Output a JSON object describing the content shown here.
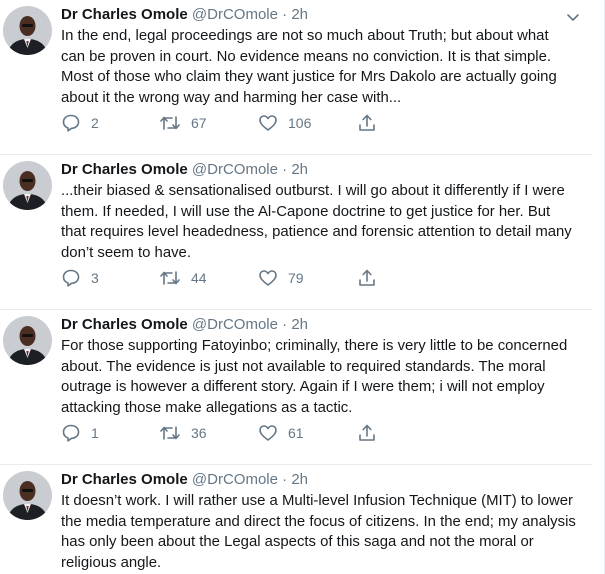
{
  "tweets": [
    {
      "name": "Dr Charles Omole",
      "handle": "@DrCOmole",
      "separator": "·",
      "time": "2h",
      "lines": [
        "In the end, legal proceedings are not so much about Truth; but about what",
        "can be proven in court. No evidence means no conviction. It is that simple.",
        "Most of those who claim they want justice for Mrs Dakolo are actually going",
        "about it the wrong way and harming her case with..."
      ],
      "replies": "2",
      "retweets": "67",
      "likes": "106"
    },
    {
      "name": "Dr Charles Omole",
      "handle": "@DrCOmole",
      "separator": "·",
      "time": "2h",
      "lines": [
        "...their biased & sensationalised outburst. I will go about it differently if I were",
        "them. If needed, I will use the Al-Capone doctrine to get justice for her. But",
        "that requires level headedness, patience and forensic attention to detail many",
        "don’t seem to have."
      ],
      "replies": "3",
      "retweets": "44",
      "likes": "79"
    },
    {
      "name": "Dr Charles Omole",
      "handle": "@DrCOmole",
      "separator": "·",
      "time": "2h",
      "lines": [
        "For those supporting Fatoyinbo; criminally, there is very little to be concerned",
        "about. The evidence is just not available to required standards. The moral",
        "outrage is however a different story. Again if I were them; i will not employ",
        "attacking those make allegations as a tactic."
      ],
      "replies": "1",
      "retweets": "36",
      "likes": "61"
    },
    {
      "name": "Dr Charles Omole",
      "handle": "@DrCOmole",
      "separator": "·",
      "time": "2h",
      "lines": [
        "It doesn’t work. I will rather use a Multi-level Infusion Technique (MIT) to lower",
        "the media temperature and direct the focus of citizens. In the end; my analysis",
        "has only been about the Legal aspects of this saga and not the moral or",
        "religious angle."
      ]
    }
  ],
  "colors": {
    "text": "#14171a",
    "secondary": "#657786",
    "divider": "#e6ecf0"
  },
  "icons": {
    "reply": "reply-icon",
    "retweet": "retweet-icon",
    "like": "like-icon",
    "share": "share-icon",
    "caret": "chevron-down-icon"
  }
}
